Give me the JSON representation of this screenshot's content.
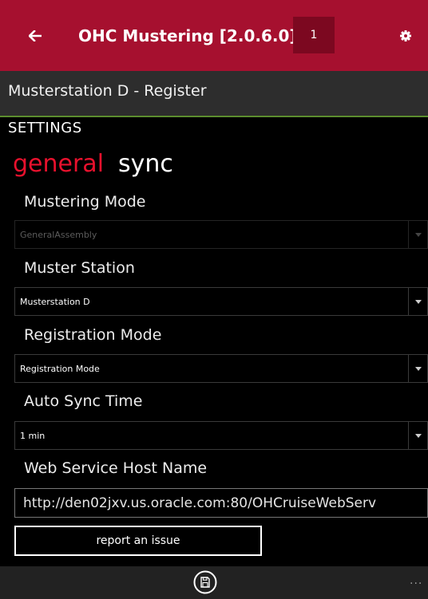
{
  "header": {
    "title": "OHC Mustering [2.0.6.0]",
    "badge": "1",
    "back_icon": "arrow-left-icon",
    "settings_icon": "gear-icon"
  },
  "subheader": {
    "title": "Musterstation D - Register"
  },
  "settings": {
    "heading": "SETTINGS",
    "tabs": [
      {
        "label": "general",
        "selected": true
      },
      {
        "label": "sync",
        "selected": false
      }
    ],
    "fields": {
      "mustering_mode": {
        "label": "Mustering Mode",
        "value": "GeneralAssembly",
        "disabled": true
      },
      "muster_station": {
        "label": "Muster Station",
        "value": "Musterstation D"
      },
      "registration_mode": {
        "label": "Registration Mode",
        "value": "Registration Mode"
      },
      "auto_sync_time": {
        "label": "Auto Sync Time",
        "value": "1 min"
      },
      "web_service_host": {
        "label": "Web Service Host Name",
        "value": "http://den02jxv.us.oracle.com:80/OHCruiseWebServ"
      }
    },
    "report_button": "report an issue"
  },
  "appbar": {
    "save_icon": "save-icon",
    "more_label": "..."
  },
  "colors": {
    "titlebar": "#a6102f",
    "badge": "#7c0820",
    "accent_tab": "#e8112d",
    "subheader": "#2d2d2d",
    "subheader_border": "#5b8d2e",
    "appbar": "#222222"
  }
}
